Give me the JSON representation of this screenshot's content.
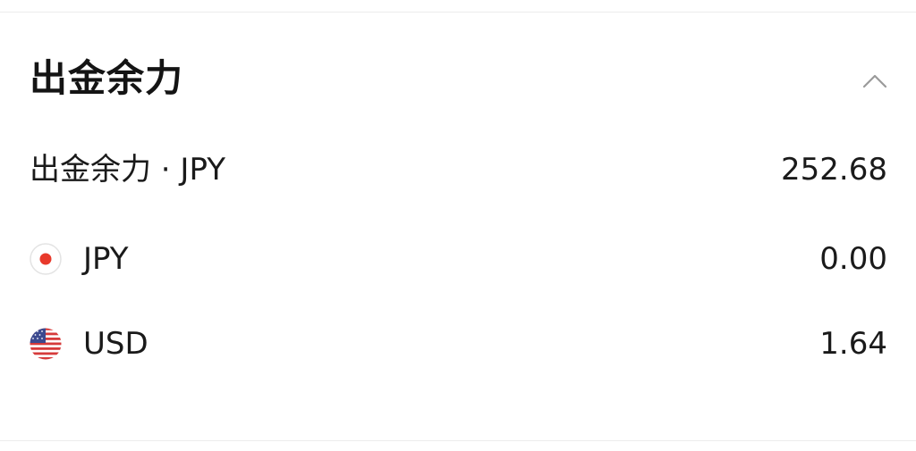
{
  "section": {
    "title": "出金余力"
  },
  "summary": {
    "label": "出金余力 · JPY",
    "value": "252.68"
  },
  "currencies": [
    {
      "code": "JPY",
      "value": "0.00",
      "icon": "japan-flag-icon"
    },
    {
      "code": "USD",
      "value": "1.64",
      "icon": "us-flag-icon"
    }
  ],
  "colors": {
    "text": "#1a1a1a",
    "divider": "#ececec",
    "chevron": "#9a9a9a",
    "japan_red": "#e8392b"
  }
}
